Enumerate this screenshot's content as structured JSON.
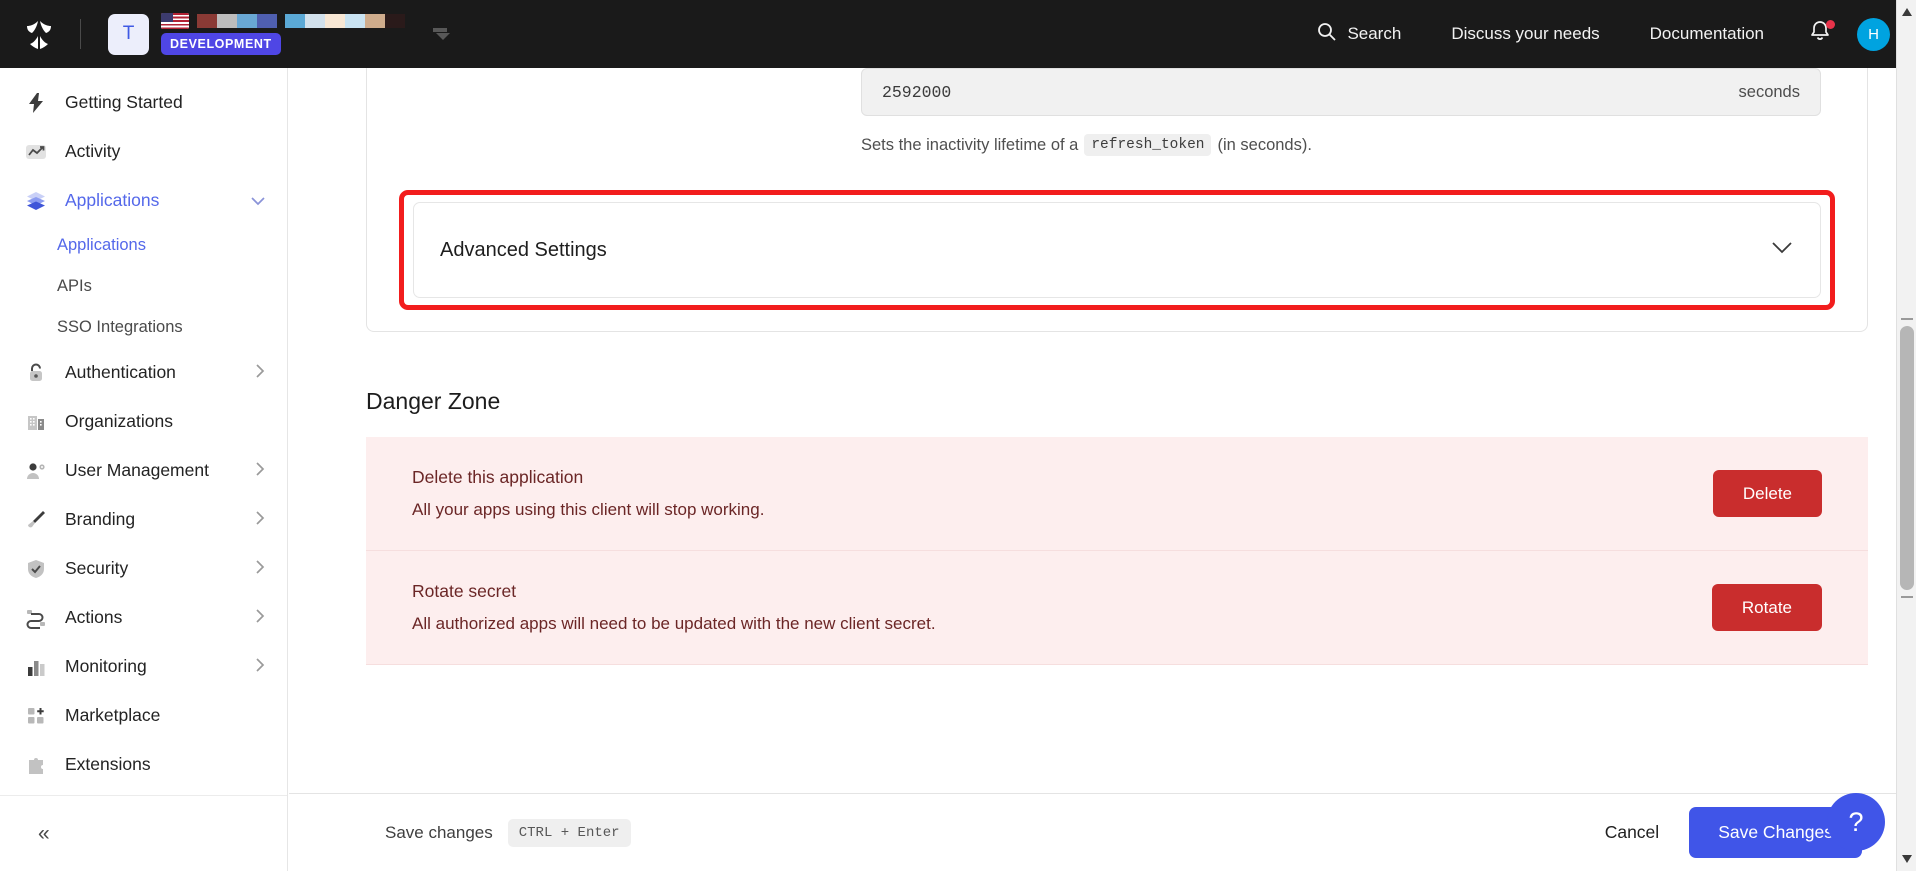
{
  "topbar": {
    "logo_icon": "shield-logo-icon",
    "tenant_initial": "T",
    "region_flag": "us-flag-icon",
    "environment_badge": "DEVELOPMENT",
    "tenant_caret_icon": "chevron-down-icon",
    "swatches_group_1": [
      "#8a3a35",
      "#bdbdbd",
      "#69a8d4",
      "#4f5fb0"
    ],
    "swatches_group_2": [
      "#5ba9d6",
      "#d2e1ec",
      "#f8e7d4",
      "#c9e3f2",
      "#cfac8c",
      "#2a1a1a"
    ],
    "nav": [
      {
        "label": "Search",
        "icon": "search-icon"
      },
      {
        "label": "Discuss your needs",
        "icon": ""
      },
      {
        "label": "Documentation",
        "icon": ""
      }
    ],
    "notifications_icon": "bell-icon",
    "has_notification_dot": true,
    "avatar_initial": "H",
    "avatar_color": "#00a3e0"
  },
  "sidebar": {
    "items": [
      {
        "label": "Getting Started",
        "icon": "bolt-icon",
        "expandable": false,
        "active": false
      },
      {
        "label": "Activity",
        "icon": "activity-chart-icon",
        "expandable": false,
        "active": false
      },
      {
        "label": "Applications",
        "icon": "layers-icon",
        "expandable": true,
        "active": true
      },
      {
        "label": "Authentication",
        "icon": "lock-icon",
        "expandable": true,
        "active": false
      },
      {
        "label": "Organizations",
        "icon": "building-icon",
        "expandable": false,
        "active": false
      },
      {
        "label": "User Management",
        "icon": "user-gear-icon",
        "expandable": true,
        "active": false
      },
      {
        "label": "Branding",
        "icon": "paintbrush-icon",
        "expandable": true,
        "active": false
      },
      {
        "label": "Security",
        "icon": "shield-check-icon",
        "expandable": true,
        "active": false
      },
      {
        "label": "Actions",
        "icon": "flow-icon",
        "expandable": true,
        "active": false
      },
      {
        "label": "Monitoring",
        "icon": "bar-chart-icon",
        "expandable": true,
        "active": false
      },
      {
        "label": "Marketplace",
        "icon": "grid-plus-icon",
        "expandable": false,
        "active": false
      },
      {
        "label": "Extensions",
        "icon": "puzzle-icon",
        "expandable": false,
        "active": false
      }
    ],
    "subitems": [
      {
        "label": "Applications",
        "active": true
      },
      {
        "label": "APIs",
        "active": false
      },
      {
        "label": "SSO Integrations",
        "active": false
      }
    ],
    "collapse_icon": "double-chevron-left-icon",
    "accent_color": "#5468ea"
  },
  "main": {
    "refresh_token_field": {
      "value": "2592000",
      "unit": "seconds",
      "help_prefix": "Sets the inactivity lifetime of a",
      "help_code": "refresh_token",
      "help_suffix": "(in seconds)."
    },
    "advanced_settings": {
      "title": "Advanced Settings",
      "chevron_icon": "chevron-down-icon",
      "highlight_color": "#f21d1d",
      "highlighted": true
    },
    "danger_zone": {
      "heading": "Danger Zone",
      "rows": [
        {
          "title": "Delete this application",
          "description": "All your apps using this client will stop working.",
          "button": "Delete"
        },
        {
          "title": "Rotate secret",
          "description": "All authorized apps will need to be updated with the new client secret.",
          "button": "Rotate"
        }
      ],
      "button_color": "#c92d2d",
      "background_color": "#fdeeee"
    }
  },
  "footer": {
    "save_hint": "Save changes",
    "shortcut": "CTRL + Enter",
    "cancel_label": "Cancel",
    "save_label": "Save Changes",
    "save_color": "#4055e8",
    "help_label": "?"
  }
}
